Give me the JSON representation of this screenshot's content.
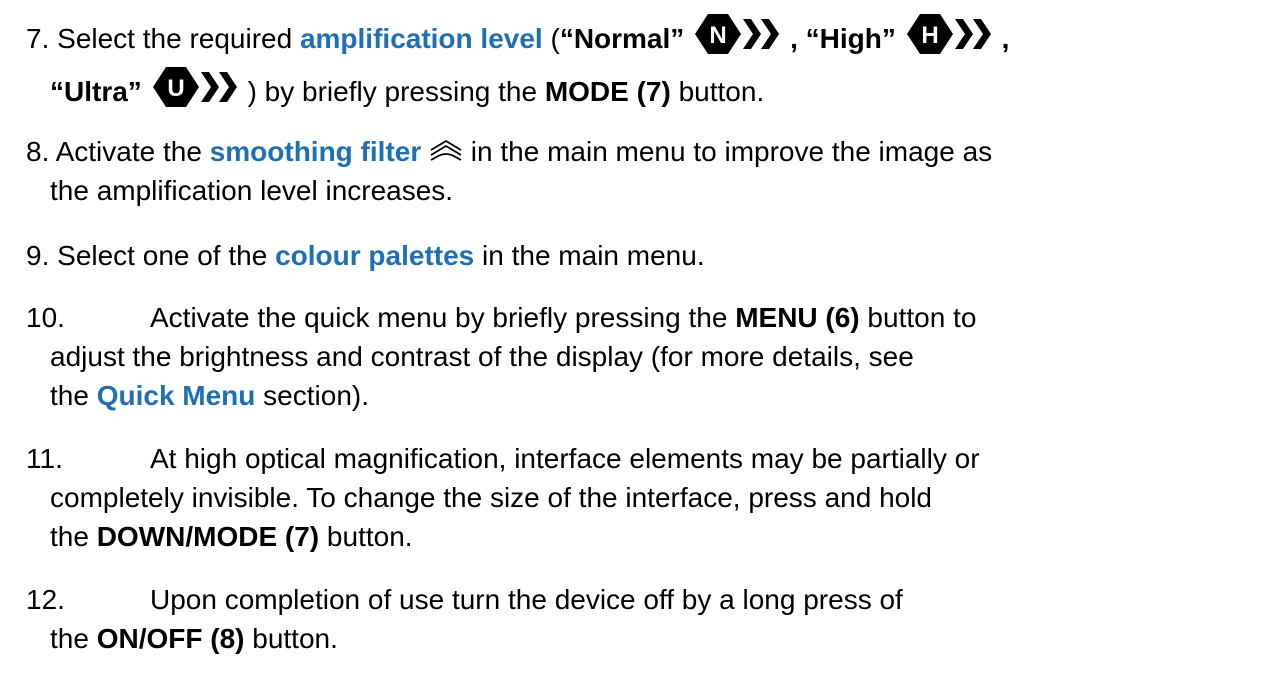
{
  "items": {
    "i7": {
      "number": "7.",
      "t1": "Select the required ",
      "hl": "amplification level",
      "t2": " (",
      "q_normal": "“Normal”",
      "sep1": ", ",
      "q_high": "“High”",
      "sep2": ",",
      "q_ultra": "“Ultra”",
      "t3": ") by briefly pressing the ",
      "b1": "MODE (7)",
      "t4": " button."
    },
    "i8": {
      "number": "8.",
      "t1": "Activate the ",
      "hl": "smoothing filter",
      "t2": " in the main menu to improve the image as",
      "t3": "the amplification level increases."
    },
    "i9": {
      "number": "9.",
      "t1": "Select one of the ",
      "hl": "colour palettes",
      "t2": " in the main menu."
    },
    "i10": {
      "number": "10.",
      "t1": "Activate the quick menu by briefly pressing the ",
      "b1": "MENU (6)",
      "t2": " button to",
      "t3": "adjust the brightness and contrast of the display (for more details, see",
      "t4": "the ",
      "hl": "Quick Menu",
      "t5": " section)."
    },
    "i11": {
      "number": "11.",
      "t1": "At high optical magnification, interface elements may be partially or",
      "t2": "completely invisible. To change the size of the interface, press and hold",
      "t3": "the ",
      "b1": "DOWN/MODE (7)",
      "t4": " button."
    },
    "i12": {
      "number": "12.",
      "t1": "Upon completion of use turn the device off by a long press of",
      "t2": "the ",
      "b1": "ON/OFF (8)",
      "t3": " button."
    }
  },
  "icons": {
    "mode_normal": {
      "name": "mode-normal-icon",
      "letter": "N"
    },
    "mode_high": {
      "name": "mode-high-icon",
      "letter": "H"
    },
    "mode_ultra": {
      "name": "mode-ultra-icon",
      "letter": "U"
    },
    "smoothing": {
      "name": "smoothing-filter-icon"
    }
  },
  "colors": {
    "highlight": "#1f6fb3",
    "text": "#000000"
  }
}
